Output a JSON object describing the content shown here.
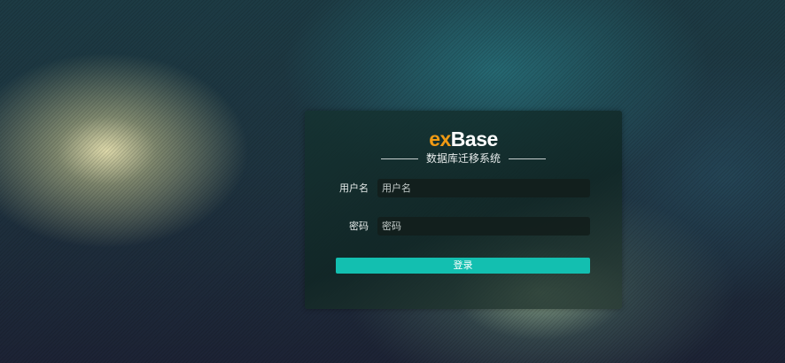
{
  "app": {
    "logo_prefix": "ex",
    "logo_suffix": "Base",
    "subtitle": "数据库迁移系统"
  },
  "form": {
    "username": {
      "label": "用户名",
      "placeholder": "用户名",
      "value": ""
    },
    "password": {
      "label": "密码",
      "placeholder": "密码",
      "value": ""
    },
    "submit_label": "登录"
  },
  "colors": {
    "logo_accent": "#f09a14",
    "button": "#13bfb0"
  }
}
